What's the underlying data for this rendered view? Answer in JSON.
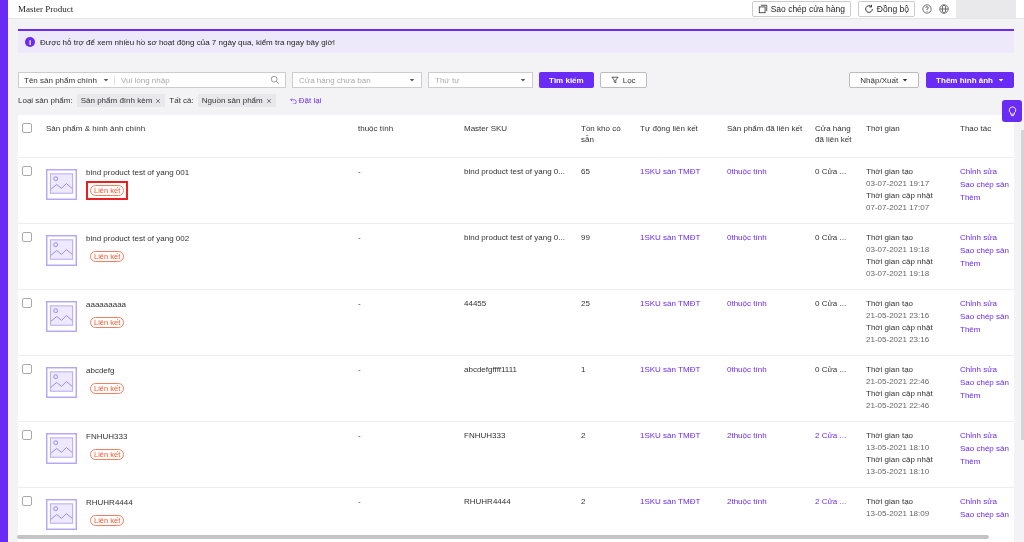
{
  "header": {
    "title": "Master Product",
    "buttons": [
      {
        "kind": "copy",
        "label": "Sao chép cửa hàng"
      },
      {
        "kind": "sync",
        "label": "Đồng bộ"
      }
    ]
  },
  "banner": {
    "icon": "i",
    "text": "Được hỗ trợ để xem nhiều hồ sơ hoạt động của 7 ngày qua, kiểm tra ngay bây giờ!"
  },
  "filters": {
    "field_select": "Tên sản phẩm chính",
    "search": {
      "placeholder": "Vui lòng nhập"
    },
    "store_select": {
      "placeholder": "Cửa hàng chưa bán"
    },
    "order_select": {
      "placeholder": "Thứ tự"
    },
    "search_button": "Tìm kiếm",
    "filter_button": "Lọc",
    "import_export": "Nhập/Xuất",
    "add_images": "Thêm hình ảnh"
  },
  "active_filters": [
    {
      "label": "Loại sản phẩm:",
      "value": "Sản phẩm đính kèm"
    },
    {
      "label": "Tất cả:",
      "value": "Nguồn sản phẩm"
    }
  ],
  "reset": "Đặt lại",
  "table": {
    "header_checked": false,
    "columns": [
      "Sản phẩm & hình ảnh chính",
      "thuộc tính",
      "Master SKU",
      "Tồn kho có sẵn",
      "Tự động liên kết",
      "Sản phẩm đã liên kết",
      "Cửa hàng đã liên kết",
      "Thời gian",
      "Thao tác"
    ],
    "rows": [
      {
        "checked": false,
        "name": "bind product test of yang 001",
        "tag": "Liên kết",
        "highlighted": true,
        "attribute": "-",
        "sku": "bind product test of yang 0...",
        "stock": "65",
        "auto_link": "1SKU sàn TMĐT",
        "linked": "0thuộc tính",
        "stores": "0 Cửa ...",
        "created_label": "Thời gian tạo",
        "created": "03-07-2021 19:17",
        "updated_label": "Thời gian cập nhật",
        "updated": "07-07-2021 17:07",
        "actions": [
          "Chỉnh sửa",
          "Sao chép sản",
          "Thêm"
        ]
      },
      {
        "checked": false,
        "name": "bind product test of yang 002",
        "tag": "Liên kết",
        "highlighted": false,
        "attribute": "-",
        "sku": "bind product test of yang 0...",
        "stock": "99",
        "auto_link": "1SKU sàn TMĐT",
        "linked": "0thuộc tính",
        "stores": "0 Cửa ...",
        "created_label": "Thời gian tạo",
        "created": "03-07-2021 19:18",
        "updated_label": "Thời gian cập nhật",
        "updated": "03-07-2021 19:18",
        "actions": [
          "Chỉnh sửa",
          "Sao chép sản",
          "Thêm"
        ]
      },
      {
        "checked": false,
        "name": "aaaaaaaaa",
        "tag": "Liên kết",
        "highlighted": false,
        "attribute": "-",
        "sku": "44455",
        "stock": "25",
        "auto_link": "1SKU sàn TMĐT",
        "linked": "0thuộc tính",
        "stores": "0 Cửa ...",
        "created_label": "Thời gian tạo",
        "created": "21-05-2021 23:16",
        "updated_label": "Thời gian cập nhật",
        "updated": "21-05-2021 23:16",
        "actions": [
          "Chỉnh sửa",
          "Sao chép sản",
          "Thêm"
        ]
      },
      {
        "checked": false,
        "name": "abcdefg",
        "tag": "Liên kết",
        "highlighted": false,
        "attribute": "-",
        "sku": "abcdefgffff1111",
        "stock": "1",
        "auto_link": "1SKU sàn TMĐT",
        "linked": "0thuộc tính",
        "stores": "0 Cửa ...",
        "created_label": "Thời gian tạo",
        "created": "21-05-2021 22:46",
        "updated_label": "Thời gian cập nhật",
        "updated": "21-05-2021 22:46",
        "actions": [
          "Chỉnh sửa",
          "Sao chép sản",
          "Thêm"
        ]
      },
      {
        "checked": false,
        "name": "FNHUH333",
        "tag": "Liên kết",
        "highlighted": false,
        "attribute": "-",
        "sku": "FNHUH333",
        "stock": "2",
        "auto_link": "1SKU sàn TMĐT",
        "linked": "2thuộc tính",
        "stores": "2 Cửa ...",
        "created_label": "Thời gian tạo",
        "created": "13-05-2021 18:10",
        "updated_label": "Thời gian cập nhật",
        "updated": "13-05-2021 18:10",
        "actions": [
          "Chỉnh sửa",
          "Sao chép sản",
          "Thêm"
        ]
      },
      {
        "checked": false,
        "name": "RHUHR4444",
        "tag": "Liên kết",
        "highlighted": false,
        "attribute": "-",
        "sku": "RHUHR4444",
        "stock": "2",
        "auto_link": "1SKU sàn TMĐT",
        "linked": "2thuộc tính",
        "stores": "2 Cửa ...",
        "created_label": "Thời gian tạo",
        "created": "13-05-2021 18:09",
        "actions": [
          "Chỉnh sửa",
          "Sao chép sản"
        ]
      }
    ]
  }
}
